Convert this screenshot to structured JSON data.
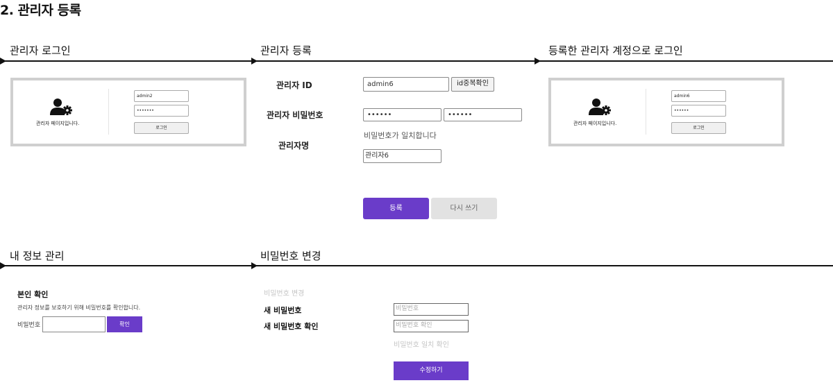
{
  "page": {
    "title": "2. 관리자 등록"
  },
  "sections": {
    "login": "관리자 로그인",
    "register": "관리자 등록",
    "login_after": "등록한 관리자 계정으로 로그인",
    "my_info": "내 정보 관리",
    "pw_change": "비밀번호 변경"
  },
  "login_mock": {
    "caption": "관리자 페이지입니다.",
    "id_value": "admin2",
    "pw_value": "•••••••",
    "button": "로그인",
    "icon": "admin-settings-icon"
  },
  "login_after_mock": {
    "caption": "관리자 페이지입니다.",
    "id_value": "admin6",
    "pw_value": "••••••",
    "button": "로그인",
    "icon": "admin-settings-icon"
  },
  "register_form": {
    "id_label": "관리자 ID",
    "id_value": "admin6",
    "dup_check": "id중복확인",
    "pw_label": "관리자 비밀번호",
    "pw_value": "••••••",
    "pw_confirm_value": "••••••",
    "pw_match_msg": "비밀번호가 일치합니다",
    "name_label": "관리자명",
    "name_value": "관리자6",
    "submit": "등록",
    "reset": "다시 쓰기"
  },
  "my_info": {
    "title": "본인 확인",
    "desc": "관리자 정보를 보호하기 위해 비밀번호를 확인합니다.",
    "pw_label": "비밀번호",
    "confirm": "확인"
  },
  "pw_change": {
    "heading": "비밀번호 변경",
    "new_pw_label": "새 비밀번호",
    "new_pw_placeholder": "비밀번호",
    "confirm_label": "새 비밀번호 확인",
    "confirm_placeholder": "비밀번호 확인",
    "match_hint": "비밀번호 일치 확인",
    "submit": "수정하기"
  },
  "colors": {
    "accent": "#6a3cc9",
    "frame": "#cfcfcf"
  }
}
